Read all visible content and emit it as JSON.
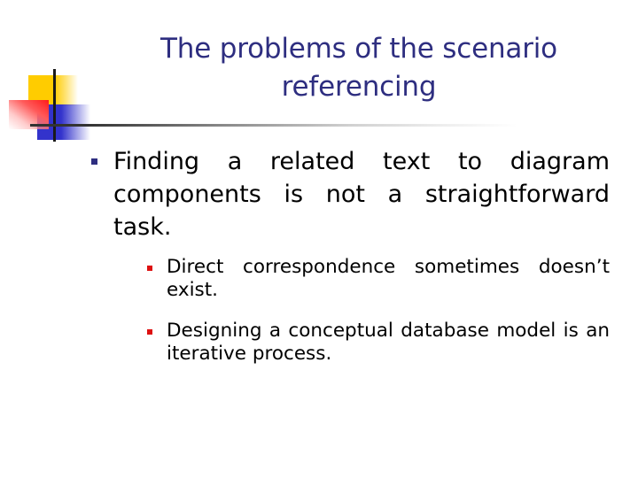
{
  "slide": {
    "title_lines": [
      "The problems of the scenario",
      "referencing"
    ],
    "bullets": [
      {
        "text": "Finding a related text to diagram components is not a straightforward task.",
        "bullet_icon": "navy-square-bullet",
        "sub_bullets": [
          {
            "text": "Direct correspondence sometimes doesn’t exist.",
            "bullet_icon": "red-square-bullet"
          },
          {
            "text": "Designing a conceptual database model is an iterative process.",
            "bullet_icon": "red-square-bullet"
          }
        ]
      }
    ],
    "colors": {
      "title": "#2e2e80",
      "level1_bullet": "#2e2e80",
      "level2_bullet": "#dd1111",
      "body_text": "#000000",
      "deco_yellow": "#ffcc00",
      "deco_blue": "#3333cc",
      "deco_red": "#ff1a1a",
      "deco_line": "#1a1a1a"
    }
  }
}
